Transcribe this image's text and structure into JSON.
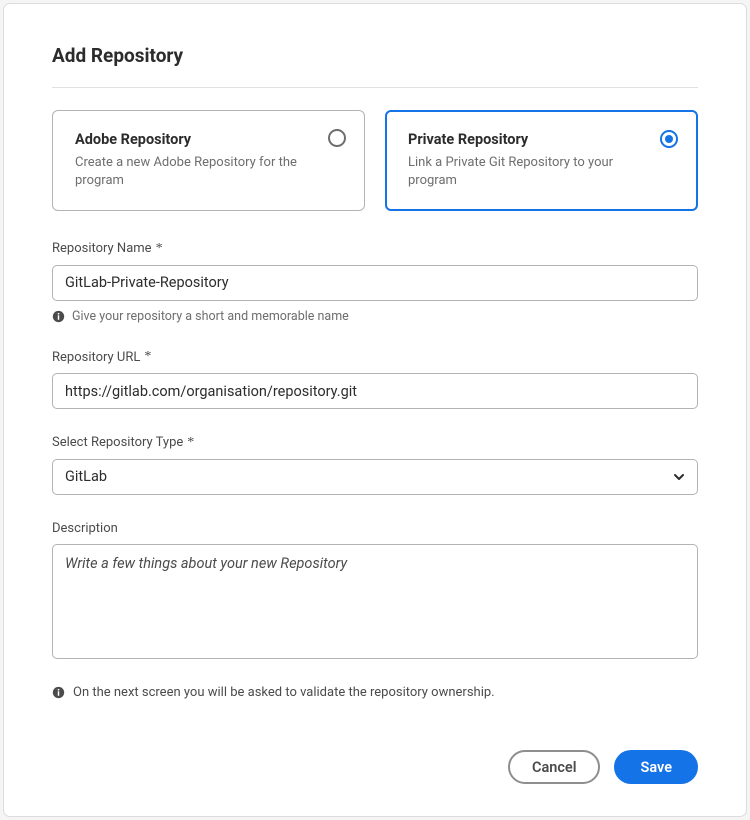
{
  "title": "Add Repository",
  "cards": {
    "adobe": {
      "title": "Adobe Repository",
      "desc": "Create a new Adobe Repository for the program",
      "selected": false
    },
    "private": {
      "title": "Private Repository",
      "desc": "Link a Private Git Repository to your program",
      "selected": true
    }
  },
  "fields": {
    "repo_name": {
      "label": "Repository Name",
      "required_mark": "*",
      "value": "GitLab-Private-Repository",
      "helper": "Give your repository a short and memorable name"
    },
    "repo_url": {
      "label": "Repository URL",
      "required_mark": "*",
      "value": "https://gitlab.com/organisation/repository.git"
    },
    "repo_type": {
      "label": "Select Repository Type",
      "required_mark": "*",
      "value": "GitLab"
    },
    "description": {
      "label": "Description",
      "placeholder": "Write a few things about your new Repository"
    }
  },
  "note": "On the next screen you will be asked to validate the repository ownership.",
  "buttons": {
    "cancel": "Cancel",
    "save": "Save"
  }
}
